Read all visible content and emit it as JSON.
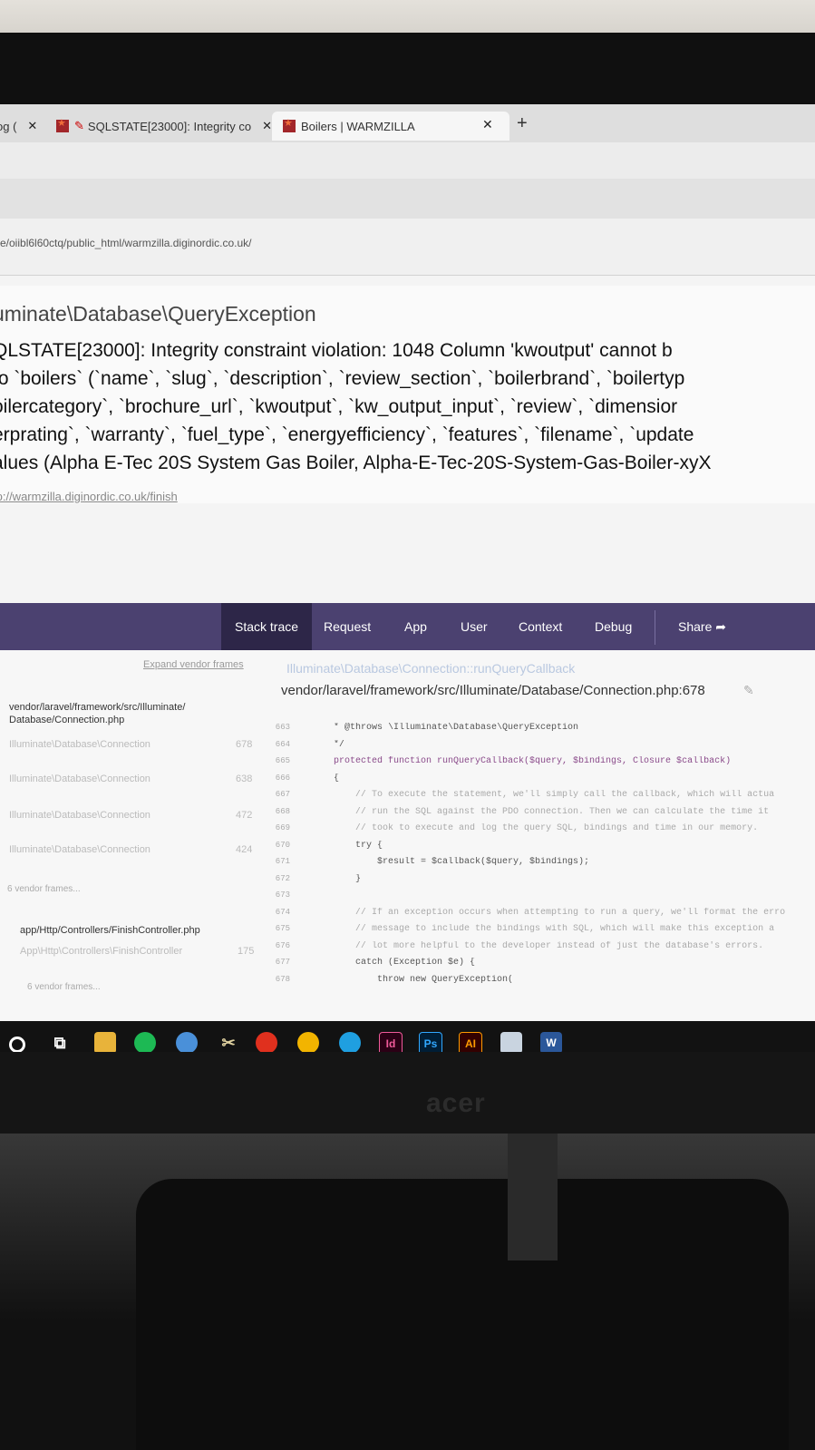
{
  "tabs": [
    {
      "label": "og (",
      "close": "✕"
    },
    {
      "label": "SQLSTATE[23000]: Integrity co",
      "close": "✕"
    },
    {
      "label": "Boilers | WARMZILLA",
      "close": "✕"
    }
  ],
  "new_tab": "+",
  "path": "e/oiibl6l60ctq/public_html/warmzilla.diginordic.co.uk/",
  "exception": {
    "class": "uminate\\Database\\QueryException",
    "message_lines": [
      "QLSTATE[23000]: Integrity constraint violation: 1048 Column 'kwoutput' cannot b",
      "to `boilers` (`name`, `slug`, `description`, `review_section`, `boilerbrand`, `boilertyp",
      "oilercategory`, `brochure_url`, `kwoutput`, `kw_output_input`, `review`, `dimensior",
      "erprating`, `warranty`, `fuel_type`, `energyefficiency`, `features`, `filename`, `update",
      "alues (Alpha E-Tec 20S System Gas Boiler, Alpha-E-Tec-20S-System-Gas-Boiler-xyX"
    ],
    "url": "tp://warmzilla.diginordic.co.uk/finish"
  },
  "nav": {
    "stack_trace": "Stack trace",
    "request": "Request",
    "app": "App",
    "user": "User",
    "context": "Context",
    "debug": "Debug",
    "share": "Share"
  },
  "left_panel": {
    "expand": "Expand vendor frames",
    "file1": "vendor/laravel/framework/src/Illuminate/\nDatabase/Connection.php",
    "frames1": [
      {
        "label": "Illuminate\\Database\\Connection",
        "line": "678"
      },
      {
        "label": "Illuminate\\Database\\Connection",
        "line": "638"
      },
      {
        "label": "Illuminate\\Database\\Connection",
        "line": "472"
      },
      {
        "label": "Illuminate\\Database\\Connection",
        "line": "424"
      }
    ],
    "vendor1": "6 vendor frames...",
    "file2": "app/Http/Controllers/FinishController.php",
    "frames2": [
      {
        "label": "App\\Http\\Controllers\\FinishController",
        "line": "175"
      }
    ],
    "vendor2": "6 vendor frames..."
  },
  "frame": {
    "class": "Illuminate\\Database\\Connection::runQueryCallback",
    "path": "vendor/laravel/framework/src/Illuminate/Database/Connection.php:678"
  },
  "code": {
    "line_numbers": [
      "663",
      "664",
      "665",
      "666",
      "667",
      "668",
      "669",
      "670",
      "671",
      "672",
      "673",
      "674",
      "675",
      "676",
      "677",
      "678"
    ],
    "lines": [
      "* @throws \\Illuminate\\Database\\QueryException",
      "*/",
      "protected function runQueryCallback($query, $bindings, Closure $callback)",
      "{",
      "    // To execute the statement, we'll simply call the callback, which will actua",
      "    // run the SQL against the PDO connection. Then we can calculate the time it",
      "    // took to execute and log the query SQL, bindings and time in our memory.",
      "    try {",
      "        $result = $callback($query, $bindings);",
      "    }",
      "",
      "    // If an exception occurs when attempting to run a query, we'll format the erro",
      "    // message to include the bindings with SQL, which will make this exception a",
      "    // lot more helpful to the developer instead of just the database's errors.",
      "    catch (Exception $e) {",
      "        throw new QueryException("
    ]
  },
  "taskbar": {
    "id": "Id",
    "ps": "Ps",
    "ai": "AI",
    "w": "W"
  },
  "monitor_brand": "acer"
}
